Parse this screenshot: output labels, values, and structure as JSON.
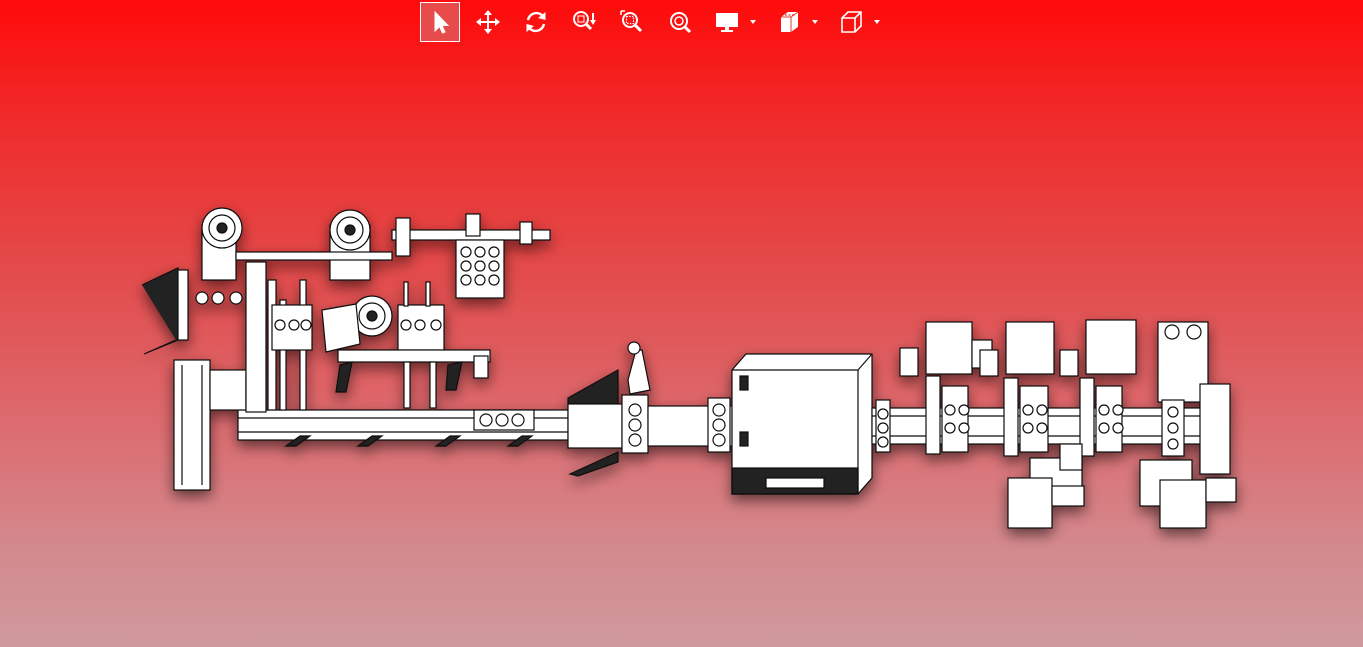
{
  "toolbar": {
    "items": [
      {
        "icon": "select-arrow-icon",
        "active": true
      },
      {
        "icon": "pan-move-icon",
        "active": false
      },
      {
        "icon": "rotate-icon",
        "active": false
      },
      {
        "icon": "zoom-fit-icon",
        "active": false
      },
      {
        "icon": "zoom-window-icon",
        "active": false
      },
      {
        "icon": "zoom-icon",
        "active": false
      },
      {
        "icon": "display-monitor-icon",
        "dropdown": true
      },
      {
        "icon": "section-view-icon",
        "dropdown": true
      },
      {
        "icon": "view-cube-icon",
        "dropdown": true
      }
    ]
  },
  "colors": {
    "background_top": "#ff0a0a",
    "background_bottom": "#cf999c",
    "active_button": "#e84b4b",
    "model_fill": "#ffffff",
    "model_line": "#111111"
  }
}
